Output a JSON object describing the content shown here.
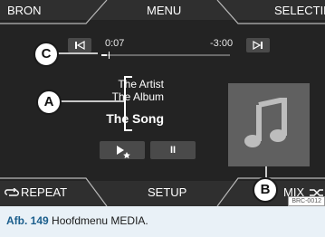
{
  "header": {
    "source_label": "BRON",
    "menu_label": "MENU",
    "select_label": "SELECTIE"
  },
  "player": {
    "elapsed": "0:07",
    "remaining": "-3:00",
    "progress_fraction": 0.04,
    "artist": "The Artist",
    "album": "The Album",
    "song": "The Song",
    "play_button_icon": "play-star-icon",
    "pause_button_icon": "pause-icon",
    "pause_glyph": "II",
    "album_art_icon": "music-note-icon"
  },
  "footer": {
    "repeat_label": "REPEAT",
    "setup_label": "SETUP",
    "mix_label": "MIX"
  },
  "callouts": {
    "a": "A",
    "b": "B",
    "c": "C"
  },
  "image_code": "BRC-0012",
  "caption": {
    "number": "Afb. 149",
    "text": "Hoofdmenu MEDIA."
  },
  "colors": {
    "screen_bg": "#232323",
    "text": "#ffffff",
    "button_bg": "#4a4a4a",
    "art_bg": "#606060",
    "caption_bg": "#e9f1f7"
  }
}
